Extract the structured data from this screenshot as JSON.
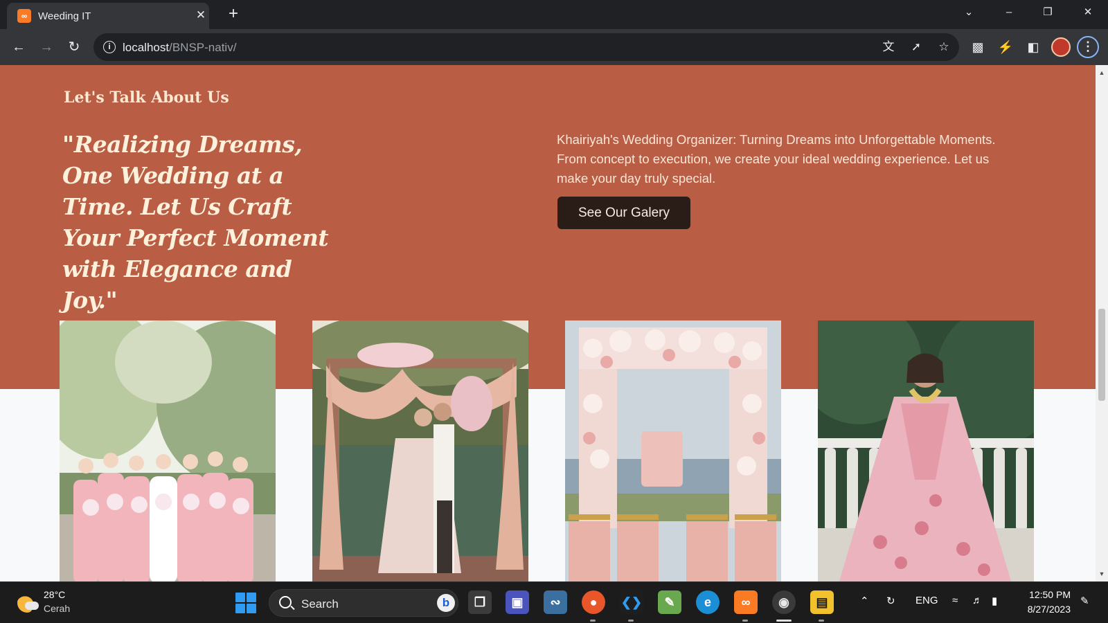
{
  "browser": {
    "tab_title": "Weeding IT",
    "tab_favicon": "xampp-icon",
    "url_host": "localhost",
    "url_path": "/BNSP-nativ/"
  },
  "about": {
    "eyebrow": "Let's Talk About Us",
    "quote": "\"Realizing Dreams, One Wedding at a Time. Let Us Craft Your Perfect Moment with Elegance and Joy.\"",
    "description": "Khairiyah's Wedding Organizer: Turning Dreams into Unforgettable Moments. From concept to execution, we create your ideal wedding experience. Let us make your day truly special.",
    "button_label": "See Our Galery",
    "colors": {
      "section_bg": "#b95d45",
      "button_bg": "#2a1d17",
      "page_bg": "#f8f9fa"
    }
  },
  "gallery": {
    "photos": [
      {
        "subject": "bridesmaids-group-photo"
      },
      {
        "subject": "couple-under-floral-arch-photo"
      },
      {
        "subject": "floral-ceremony-arch-photo"
      },
      {
        "subject": "bride-in-pink-lehenga-photo"
      }
    ]
  },
  "taskbar": {
    "weather_temp": "28°C",
    "weather_desc": "Cerah",
    "search_label": "Search",
    "language": "ENG",
    "time": "12:50 PM",
    "date": "8/27/2023"
  }
}
